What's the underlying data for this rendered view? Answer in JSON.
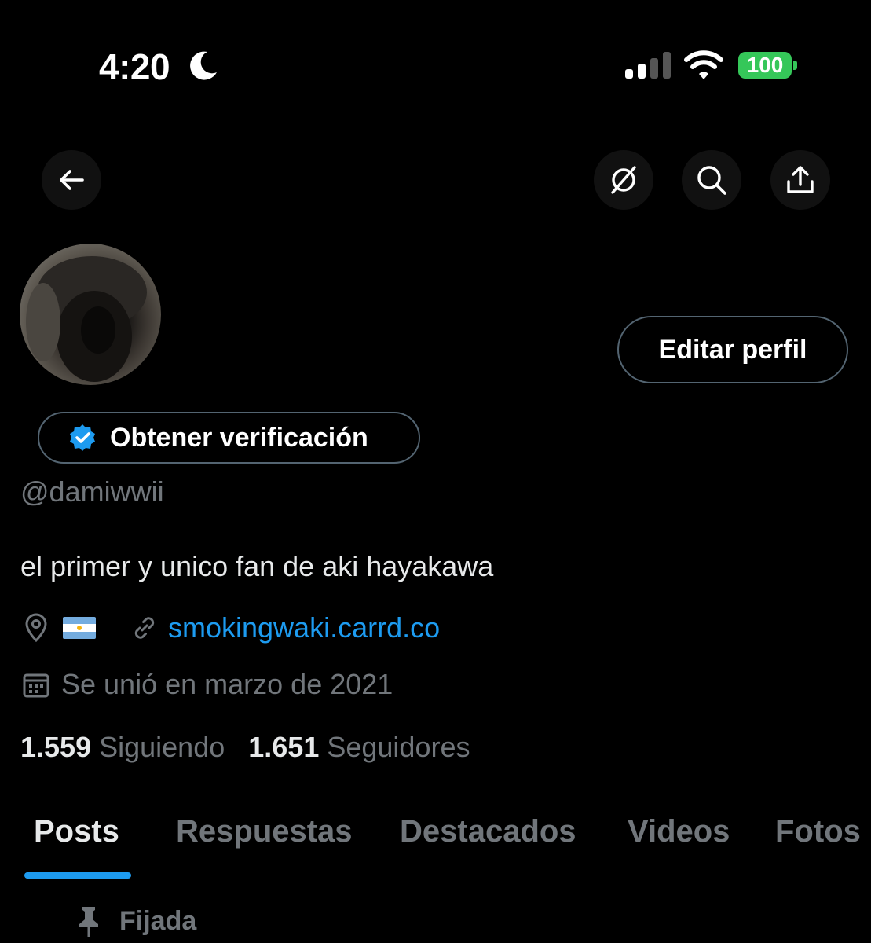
{
  "status_bar": {
    "time": "4:20",
    "battery": "100",
    "battery_color": "#35c759"
  },
  "nav": {
    "back_icon": "arrow-left-icon",
    "grok_icon": "grok-icon",
    "search_icon": "search-icon",
    "share_icon": "share-icon"
  },
  "profile": {
    "edit_button": "Editar perfil",
    "verify_button": "Obtener verificación",
    "handle": "@damiwwii",
    "bio": "el primer y unico fan de aki hayakawa",
    "link": "smokingwaki.carrd.co",
    "joined": "Se unió en marzo de 2021",
    "following_count": "1.559",
    "following_label": "Siguiendo",
    "followers_count": "1.651",
    "followers_label": "Seguidores"
  },
  "tabs": [
    {
      "label": "Posts",
      "active": true
    },
    {
      "label": "Respuestas",
      "active": false
    },
    {
      "label": "Destacados",
      "active": false
    },
    {
      "label": "Videos",
      "active": false
    },
    {
      "label": "Fotos",
      "active": false
    }
  ],
  "pinned": {
    "label": "Fijada"
  },
  "colors": {
    "accent": "#1d9bf0",
    "muted": "#71767b",
    "background": "#000000"
  }
}
